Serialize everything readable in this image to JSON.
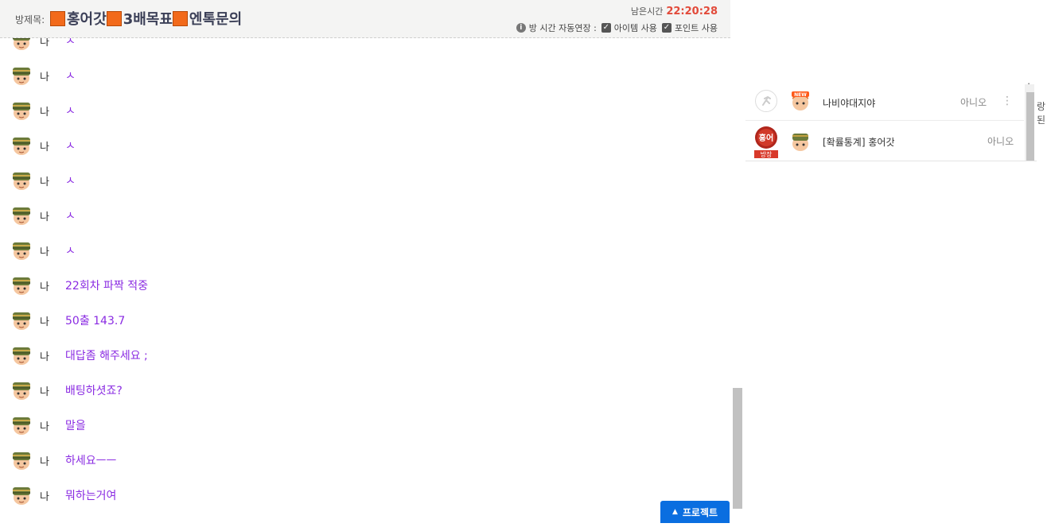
{
  "header": {
    "title_label": "방제목:",
    "title_parts": [
      "홍어갓",
      "3배목표",
      "엔톡문의"
    ],
    "timer_label": "남은시간",
    "timer_value": "22:20:28",
    "extend_label": "방 시간 자동연장 :",
    "item_label": "아이템 사용",
    "point_label": "포인트 사용"
  },
  "chat": {
    "messages": [
      {
        "nick": "나",
        "text": "ㅅ"
      },
      {
        "nick": "나",
        "text": "ㅅ"
      },
      {
        "nick": "나",
        "text": "ㅅ"
      },
      {
        "nick": "나",
        "text": "ㅅ"
      },
      {
        "nick": "나",
        "text": "ㅅ"
      },
      {
        "nick": "나",
        "text": "ㅅ"
      },
      {
        "nick": "나",
        "text": "ㅅ"
      },
      {
        "nick": "나",
        "text": "22회차 파짝 적중"
      },
      {
        "nick": "나",
        "text": "50출 143.7"
      },
      {
        "nick": "나",
        "text": "대답좀 해주세요 ;"
      },
      {
        "nick": "나",
        "text": "배팅하셧죠?"
      },
      {
        "nick": "나",
        "text": "말을"
      },
      {
        "nick": "나",
        "text": "하세요ㅡㅡ"
      },
      {
        "nick": "나",
        "text": "뭐하는거여"
      }
    ]
  },
  "project_button": "프로젝트",
  "participants": [
    {
      "name": "나비야대지야",
      "status": "아니오",
      "badge": "NEW"
    },
    {
      "name": "[확률통계] 홍어갓",
      "status": "아니오",
      "host_badge": "홍어",
      "host_label": "방장"
    }
  ],
  "edge_text": "랑 된",
  "colors": {
    "accent": "#0a6ee0",
    "chat_text": "#8a2be2",
    "timer": "#e24a3a",
    "title_square": "#f26a1b"
  }
}
